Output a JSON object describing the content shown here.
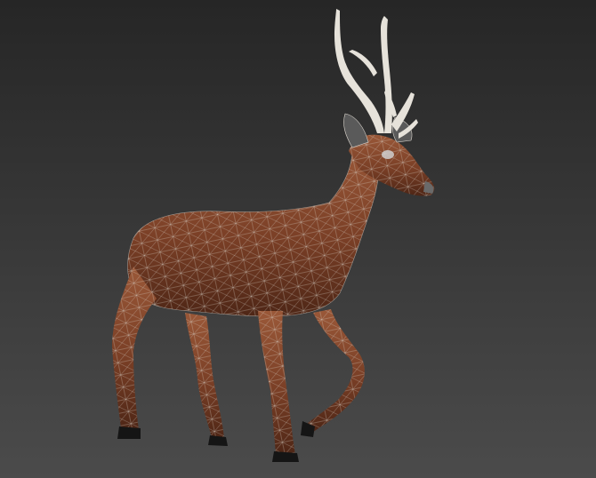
{
  "viewport": {
    "mode": "wireframe-on-shaded",
    "background_gradient": [
      "#262626",
      "#4b4b4b"
    ]
  },
  "model": {
    "subject": "deer",
    "body_color": "#7a3f26",
    "body_highlight": "#9a5838",
    "body_shadow": "#4e2616",
    "antler_color": "#e6e2da",
    "hoof_color": "#151515",
    "wire_color": "#d9d4cc"
  }
}
